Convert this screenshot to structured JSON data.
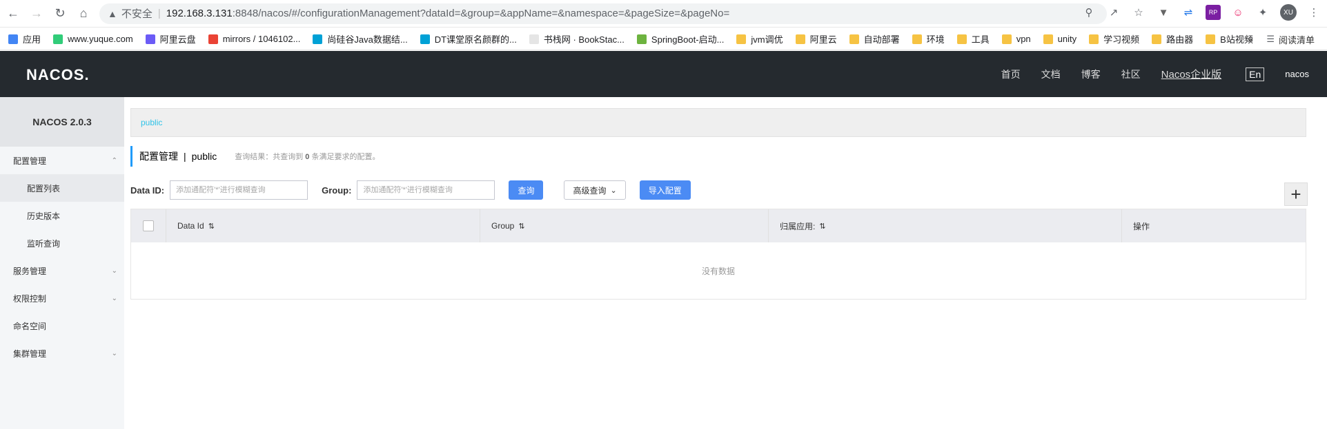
{
  "browser": {
    "insecure_label": "不安全",
    "url_host": "192.168.3.131",
    "url_path": ":8848/nacos/#/configurationManagement?dataId=&group=&appName=&namespace=&pageSize=&pageNo=",
    "avatar_text": "XU"
  },
  "bookmarks": {
    "items": [
      {
        "label": "应用",
        "icon": "apps-grid-icon"
      },
      {
        "label": "www.yuque.com",
        "icon": "yuque-icon"
      },
      {
        "label": "阿里云盘",
        "icon": "aliyun-drive-icon"
      },
      {
        "label": "mirrors / 1046102...",
        "icon": "google-icon"
      },
      {
        "label": "尚硅谷Java数据结...",
        "icon": "bilibili-icon"
      },
      {
        "label": "DT课堂原名颜群的...",
        "icon": "bilibili-icon"
      },
      {
        "label": "书栈网 · BookStac...",
        "icon": "book-icon"
      },
      {
        "label": "SpringBoot-启动...",
        "icon": "spring-icon"
      },
      {
        "label": "jvm调优",
        "icon": "folder-icon"
      },
      {
        "label": "阿里云",
        "icon": "folder-icon"
      },
      {
        "label": "自动部署",
        "icon": "folder-icon"
      },
      {
        "label": "环境",
        "icon": "folder-icon"
      },
      {
        "label": "工具",
        "icon": "folder-icon"
      },
      {
        "label": "vpn",
        "icon": "folder-icon"
      },
      {
        "label": "unity",
        "icon": "folder-icon"
      },
      {
        "label": "学习视频",
        "icon": "folder-icon"
      },
      {
        "label": "路由器",
        "icon": "folder-icon"
      },
      {
        "label": "B站视频",
        "icon": "folder-icon"
      }
    ],
    "more": "»",
    "reading_list": "阅读清单"
  },
  "header": {
    "logo": "NACOS.",
    "menu": [
      "首页",
      "文档",
      "博客",
      "社区"
    ],
    "enterprise": "Nacos企业版",
    "lang": "En",
    "user": "nacos"
  },
  "sidebar": {
    "title": "NACOS 2.0.3",
    "items": [
      {
        "label": "配置管理",
        "sub": false,
        "chevron": "up"
      },
      {
        "label": "配置列表",
        "sub": true,
        "chevron": ""
      },
      {
        "label": "历史版本",
        "sub": true,
        "chevron": ""
      },
      {
        "label": "监听查询",
        "sub": true,
        "chevron": ""
      },
      {
        "label": "服务管理",
        "sub": false,
        "chevron": "down"
      },
      {
        "label": "权限控制",
        "sub": false,
        "chevron": "down"
      },
      {
        "label": "命名空间",
        "sub": false,
        "chevron": ""
      },
      {
        "label": "集群管理",
        "sub": false,
        "chevron": "down"
      }
    ]
  },
  "main": {
    "namespace_tab": "public",
    "title": "配置管理",
    "title_sep": "|",
    "title_ns": "public",
    "result_prefix": "查询结果：共查询到",
    "result_count": "0",
    "result_suffix": "条满足要求的配置。",
    "dataid_label": "Data ID:",
    "dataid_placeholder": "添加通配符'*'进行模糊查询",
    "group_label": "Group:",
    "group_placeholder": "添加通配符'*'进行模糊查询",
    "query_button": "查询",
    "advanced_button": "高级查询",
    "import_button": "导入配置",
    "add_button": "+",
    "columns": [
      "Data Id",
      "Group",
      "归属应用:",
      "操作"
    ],
    "empty_text": "没有数据"
  },
  "colors": {
    "header_bg": "#252a2f",
    "primary": "#4b8bf4",
    "accent": "#209bfa"
  }
}
